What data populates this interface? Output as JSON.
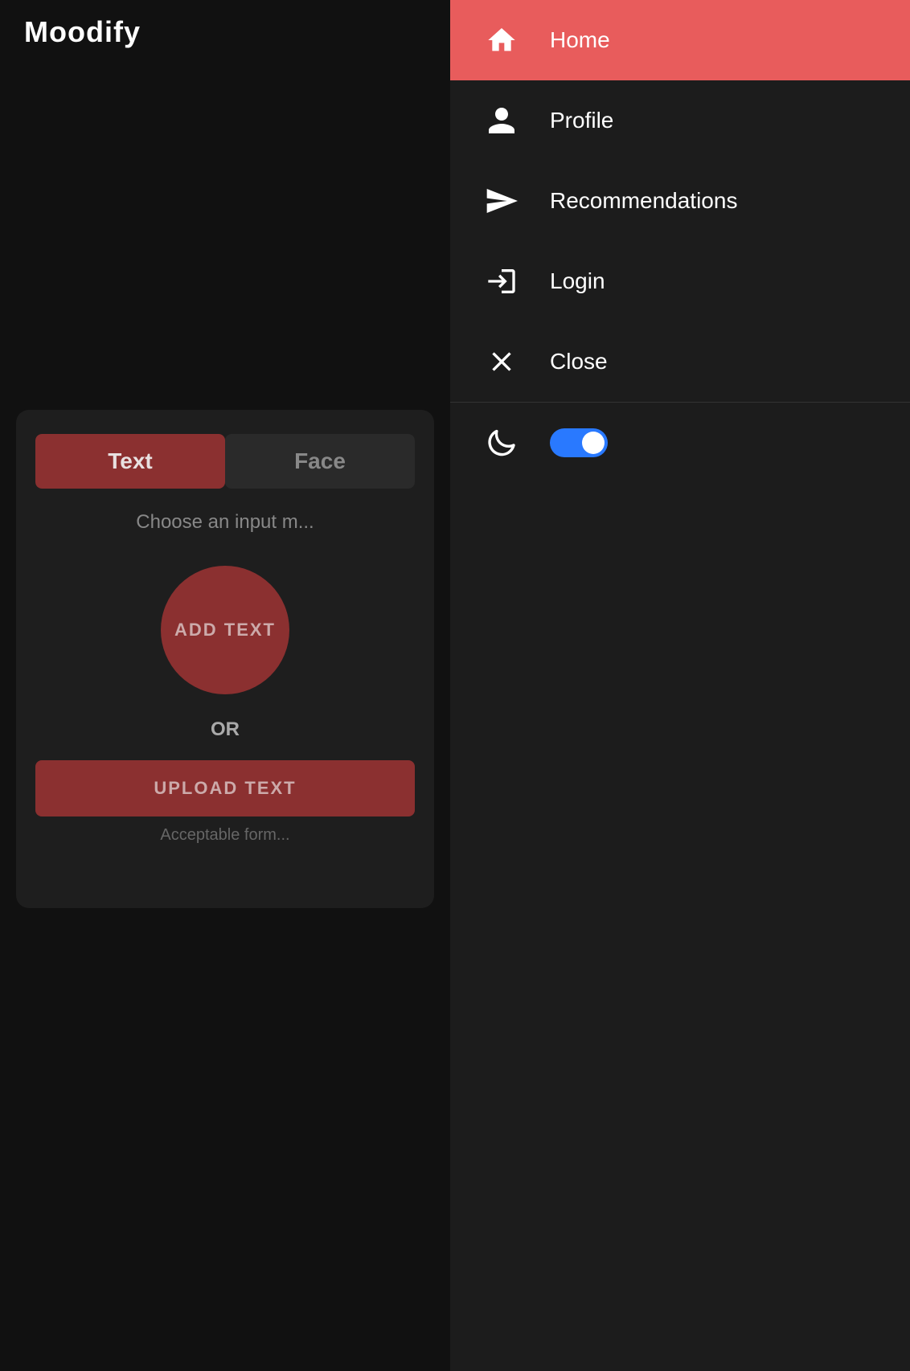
{
  "app": {
    "title": "Moodify"
  },
  "header": {
    "title": "Moodify"
  },
  "card": {
    "choose_input_label": "Choose an input m...",
    "tab_text": "Text",
    "tab_face": "Face",
    "add_text_label": "ADD TEXT",
    "or_label": "OR",
    "upload_btn_label": "UPLOAD TEXT",
    "acceptable_label": "Acceptable form..."
  },
  "nav": {
    "home_label": "Home",
    "profile_label": "Profile",
    "recommendations_label": "Recommendations",
    "login_label": "Login",
    "close_label": "Close",
    "dark_mode_enabled": true
  },
  "colors": {
    "nav_home_bg": "#e85c5c",
    "nav_bg": "#1c1c1c",
    "card_bg": "#1e1e1e",
    "tab_active": "#8b3030",
    "toggle_on": "#2979ff",
    "accent": "#8b3030",
    "body_bg": "#111111"
  }
}
